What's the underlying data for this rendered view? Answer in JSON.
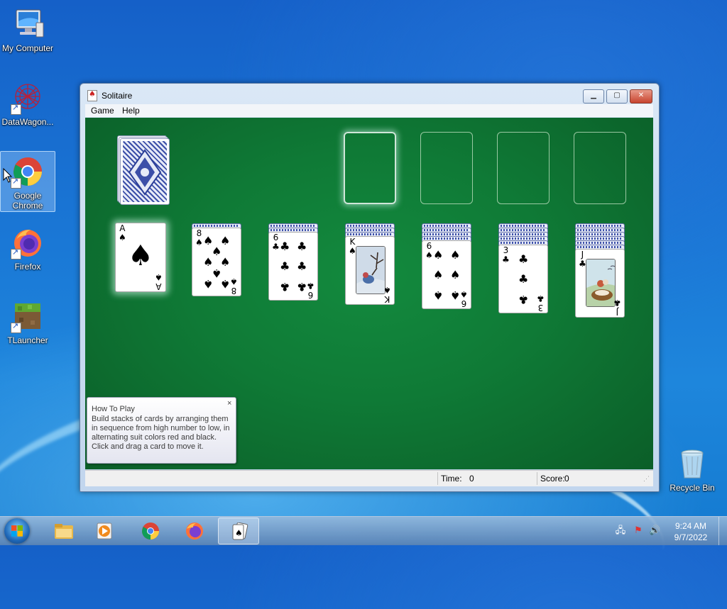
{
  "desktop": {
    "icons": [
      {
        "label": "My Computer"
      },
      {
        "label": "DataWagon..."
      },
      {
        "label": "Google Chrome"
      },
      {
        "label": "Firefox"
      },
      {
        "label": "TLauncher"
      },
      {
        "label": "Recycle Bin"
      }
    ]
  },
  "window": {
    "title": "Solitaire",
    "menu": [
      "Game",
      "Help"
    ],
    "controls": {
      "minimize": "▁",
      "maximize": "▢",
      "close": "✕"
    }
  },
  "game": {
    "foundations": 4,
    "stock": "face-down deck",
    "tableau": [
      {
        "hidden": 0,
        "rank": "A",
        "suit": "♠"
      },
      {
        "hidden": 1,
        "rank": "8",
        "suit": "♠"
      },
      {
        "hidden": 2,
        "rank": "6",
        "suit": "♣"
      },
      {
        "hidden": 3,
        "rank": "K",
        "suit": "♠"
      },
      {
        "hidden": 4,
        "rank": "6",
        "suit": "♠"
      },
      {
        "hidden": 5,
        "rank": "3",
        "suit": "♣"
      },
      {
        "hidden": 6,
        "rank": "J",
        "suit": "♣"
      }
    ]
  },
  "howto": {
    "heading": "How To Play",
    "body": "Build stacks of cards by arranging them in sequence from high number to low, in alternating suit colors red and black. Click and drag a card to move it.",
    "close": "×"
  },
  "status": {
    "time_label": "Time:",
    "time_value": "0",
    "score_label": "Score:",
    "score_value": "0"
  },
  "taskbar": {
    "time": "9:24 AM",
    "date": "9/7/2022"
  }
}
